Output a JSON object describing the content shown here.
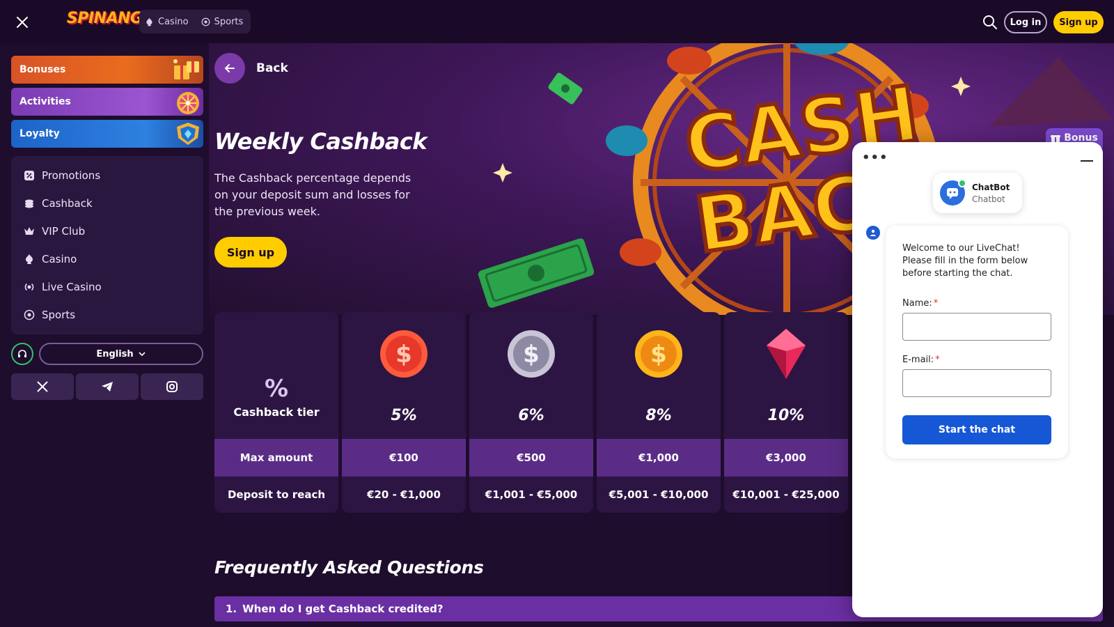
{
  "header": {
    "logo": "SPINANGA",
    "nav": [
      {
        "label": "Casino",
        "icon": "casino-icon"
      },
      {
        "label": "Sports",
        "icon": "sports-icon"
      }
    ],
    "login_label": "Log in",
    "signup_label": "Sign up"
  },
  "sidebar": {
    "cards": [
      {
        "label": "Bonuses"
      },
      {
        "label": "Activities"
      },
      {
        "label": "Loyalty"
      }
    ],
    "items": [
      {
        "label": "Promotions",
        "icon": "promotions-icon"
      },
      {
        "label": "Cashback",
        "icon": "cashback-icon"
      },
      {
        "label": "VIP Club",
        "icon": "crown-icon"
      },
      {
        "label": "Casino",
        "icon": "casino-icon"
      },
      {
        "label": "Live Casino",
        "icon": "live-casino-icon"
      },
      {
        "label": "Sports",
        "icon": "sports-icon"
      }
    ],
    "language": "English",
    "socials": [
      "x-icon",
      "telegram-icon",
      "instagram-icon"
    ]
  },
  "main": {
    "back_label": "Back",
    "title": "Weekly Cashback",
    "description": "The Cashback percentage depends on your deposit sum and losses for the previous week.",
    "signup_label": "Sign up",
    "bonus_tag": "Bonus",
    "table": {
      "header_symbol": "%",
      "header_label": "Cashback tier",
      "row_labels": {
        "max": "Max amount",
        "deposit": "Deposit to reach"
      },
      "tiers": [
        {
          "percent": "5%",
          "max": "€100",
          "deposit": "€20 - €1,000",
          "icon": "red-coin-icon"
        },
        {
          "percent": "6%",
          "max": "€500",
          "deposit": "€1,001 - €5,000",
          "icon": "silver-coin-icon"
        },
        {
          "percent": "8%",
          "max": "€1,000",
          "deposit": "€5,001 - €10,000",
          "icon": "gold-coin-icon"
        },
        {
          "percent": "10%",
          "max": "€3,000",
          "deposit": "€10,001 - €25,000",
          "icon": "ruby-gem-icon"
        }
      ]
    },
    "faq_title": "Frequently Asked Questions",
    "faq": [
      {
        "number": "1.",
        "question": "When do I get Cashback credited?"
      }
    ]
  },
  "chat": {
    "bot_name": "ChatBot",
    "bot_subtitle": "Chatbot",
    "welcome": "Welcome to our LiveChat! Please fill in the form below before starting the chat.",
    "name_label": "Name:",
    "email_label": "E-mail:",
    "required_mark": "*",
    "start_label": "Start the chat"
  },
  "colors": {
    "background": "#1e0d2c",
    "accent_yellow": "#ffcc00",
    "purple_row": "#5a2c86",
    "chat_blue": "#1657d6"
  }
}
